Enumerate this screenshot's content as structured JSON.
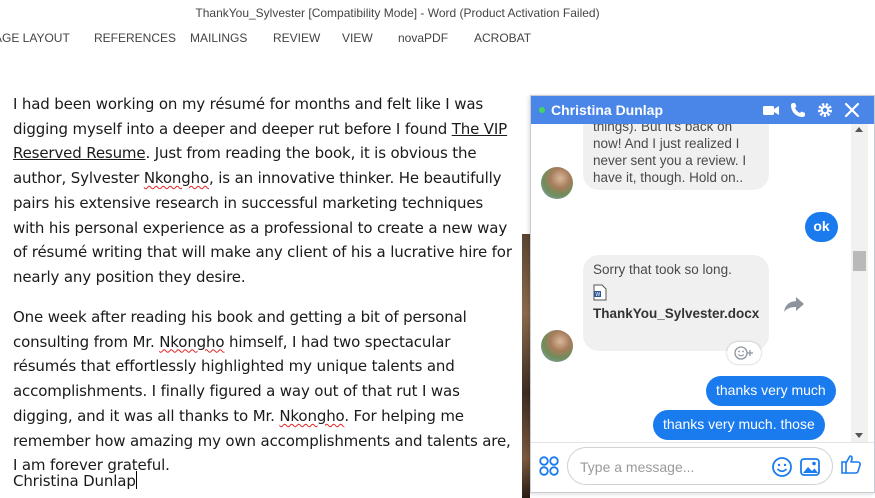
{
  "window": {
    "title": "ThankYou_Sylvester [Compatibility Mode] - Word (Product Activation Failed)"
  },
  "ribbon": {
    "tabs": [
      "AGE LAYOUT",
      "REFERENCES",
      "MAILINGS",
      "REVIEW",
      "VIEW",
      "novaPDF",
      "ACROBAT"
    ]
  },
  "document": {
    "p1": {
      "a": "I had been working on my résumé for months and felt like I was digging myself into a deeper and deeper rut before I found ",
      "link": "The VIP Reserved Resume",
      "b": ".   Just from reading the book, it is obvious the author, Sylvester ",
      "name": "Nkongho",
      "c": ", is an innovative thinker.  He beautifully pairs his extensive research in successful marketing techniques with his personal experience as a professional to create a new way of résumé writing that will make any client of his a lucrative hire for nearly any position they desire."
    },
    "p2": {
      "a": "One week after reading his book and getting a bit of personal consulting from Mr. ",
      "name1": "Nkongho",
      "b": " himself, I had two spectacular résumés that effortlessly highlighted my unique talents and accomplishments.  I finally figured a way out of that rut I was digging, and it was all thanks to Mr. ",
      "name2": "Nkongho",
      "c": ".  For helping me remember how amazing my own accomplishments and talents are, I am forever grateful."
    },
    "signature": "Christina Dunlap"
  },
  "chat": {
    "contact_name": "Christina Dunlap",
    "status_color": "#42d55f",
    "accent_color": "#4a86e8",
    "messages": {
      "in1": "things).  But it's back on now!  And I just realized I never sent you a review.  I have it, though.  Hold on..",
      "out_ok": "ok",
      "in2_text": "Sorry that took so long.",
      "in2_file": "ThankYou_Sylvester.docx",
      "out1": "thanks very much",
      "out2": "thanks very much. those"
    },
    "composer": {
      "placeholder": "Type a message..."
    }
  }
}
